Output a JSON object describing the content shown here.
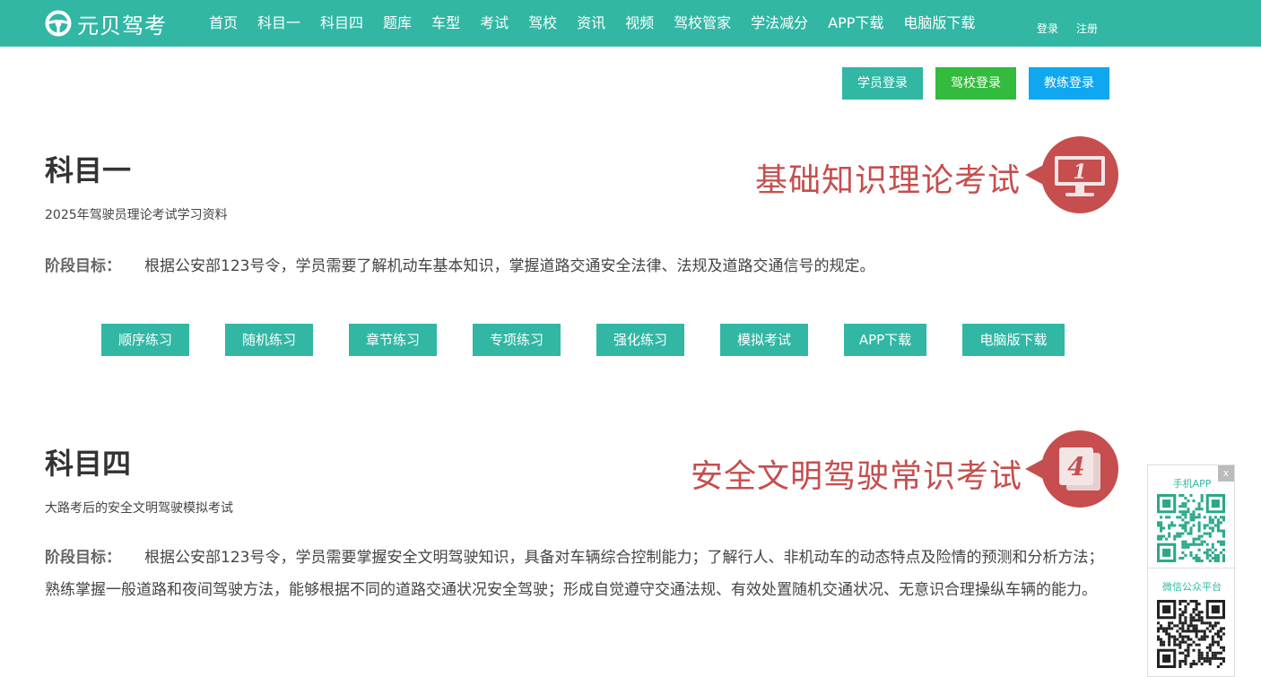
{
  "header": {
    "logo_text": "元贝驾考",
    "nav": [
      "首页",
      "科目一",
      "科目四",
      "题库",
      "车型",
      "考试",
      "驾校",
      "资讯",
      "视频",
      "驾校管家",
      "学法减分",
      "APP下载",
      "电脑版下载"
    ],
    "login": "登录",
    "register": "注册"
  },
  "login_buttons": {
    "student": "学员登录",
    "school": "驾校登录",
    "coach": "教练登录"
  },
  "subject1": {
    "title": "科目一",
    "subtitle": "2025年驾驶员理论考试学习资料",
    "goal_label": "阶段目标：",
    "goal_text": "根据公安部123号令，学员需要了解机动车基本知识，掌握道路交通安全法律、法规及道路交通信号的规定。",
    "slogan": "基础知识理论考试",
    "badge_number": "1"
  },
  "practice_buttons": [
    "顺序练习",
    "随机练习",
    "章节练习",
    "专项练习",
    "强化练习",
    "模拟考试",
    "APP下载",
    "电脑版下载"
  ],
  "subject4": {
    "title": "科目四",
    "subtitle": "大路考后的安全文明驾驶模拟考试",
    "goal_label": "阶段目标：",
    "goal_text": "根据公安部123号令，学员需要掌握安全文明驾驶知识，具备对车辆综合控制能力；了解行人、非机动车的动态特点及险情的预测和分析方法；熟练掌握一般道路和夜间驾驶方法，能够根据不同的道路交通状况安全驾驶；形成自觉遵守交通法规、有效处置随机交通状况、无意识合理操纵车辆的能力。",
    "slogan": "安全文明驾驶常识考试",
    "badge_number": "4"
  },
  "qr_panel": {
    "app_label": "手机APP",
    "wechat_label": "微信公众平台",
    "close": "x"
  },
  "colors": {
    "brand": "#31b7a4",
    "slogan": "#c64e4e",
    "school_green": "#33bb3d",
    "coach_blue": "#0fa8f0"
  },
  "icons": {
    "logo": "steering-wheel-icon",
    "badge1": "monitor-icon",
    "badge4": "pages-icon"
  }
}
